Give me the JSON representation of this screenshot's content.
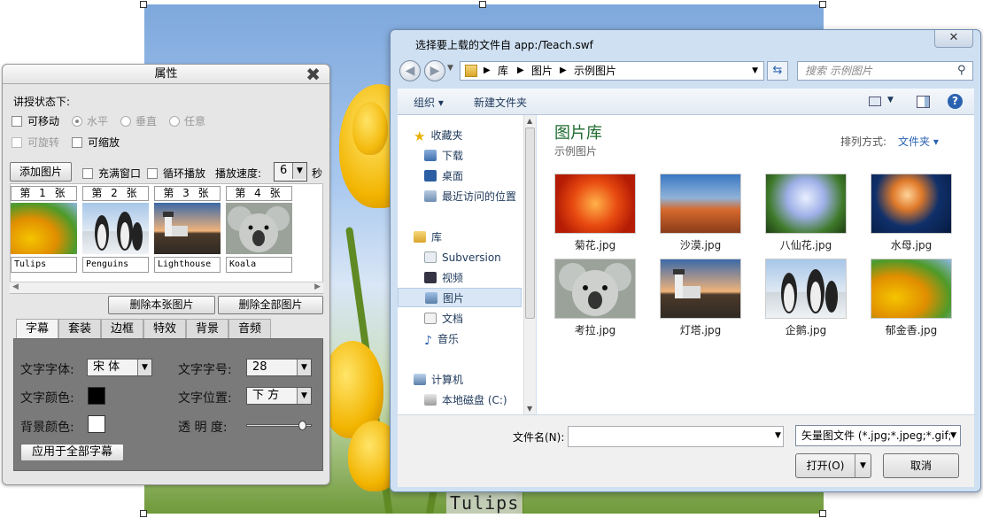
{
  "stage": {
    "caption": "Tulips"
  },
  "props": {
    "title": "属性",
    "close": "✖",
    "state_label": "讲授状态下:",
    "movable": "可移动",
    "horizontal": "水平",
    "vertical": "垂直",
    "any": "任意",
    "rotatable": "可旋转",
    "scalable": "可缩放",
    "add_image": "添加图片",
    "fill_window": "充满窗口",
    "loop_play": "循环播放",
    "speed_label": "播放速度:",
    "speed_value": "6",
    "speed_unit": "秒",
    "thumbs": [
      {
        "cap": "第 1 张",
        "name": "Tulips"
      },
      {
        "cap": "第 2 张",
        "name": "Penguins"
      },
      {
        "cap": "第 3 张",
        "name": "Lighthouse"
      },
      {
        "cap": "第 4 张",
        "name": "Koala"
      }
    ],
    "delete_one": "删除本张图片",
    "delete_all": "删除全部图片",
    "tabs": [
      "字幕",
      "套装",
      "边框",
      "特效",
      "背景",
      "音频"
    ],
    "font_label": "文字字体:",
    "font_value": "宋 体",
    "size_label": "文字字号:",
    "size_value": "28",
    "color_label": "文字颜色:",
    "pos_label": "文字位置:",
    "pos_value": "下 方",
    "bgcolor_label": "背景颜色:",
    "opacity_label": "透 明 度:",
    "opacity": 0.85,
    "apply_all": "应用于全部字幕",
    "text_color": "#000000",
    "bg_color": "#ffffff"
  },
  "dialog": {
    "title": "选择要上载的文件自 app:/Teach.swf",
    "close": "✕",
    "path": [
      "库",
      "图片",
      "示例图片"
    ],
    "search_placeholder": "搜索 示例图片",
    "organize": "组织 ▾",
    "new_folder": "新建文件夹",
    "nav": {
      "favorites": "收藏夹",
      "downloads": "下载",
      "desktop": "桌面",
      "recent": "最近访问的位置",
      "libraries": "库",
      "subversion": "Subversion",
      "videos": "视频",
      "pictures": "图片",
      "documents": "文档",
      "music": "音乐",
      "computer": "计算机",
      "local_disk": "本地磁盘 (C:)"
    },
    "library_title": "图片库",
    "library_sub": "示例图片",
    "arrange_label": "排列方式:",
    "arrange_value": "文件夹 ▾",
    "files": [
      "菊花.jpg",
      "沙漠.jpg",
      "八仙花.jpg",
      "水母.jpg",
      "考拉.jpg",
      "灯塔.jpg",
      "企鹅.jpg",
      "郁金香.jpg"
    ],
    "filename_label": "文件名(N):",
    "filetype": "矢量图文件 (*.jpg;*.jpeg;*.gif;*",
    "open": "打开(O)",
    "cancel": "取消"
  }
}
